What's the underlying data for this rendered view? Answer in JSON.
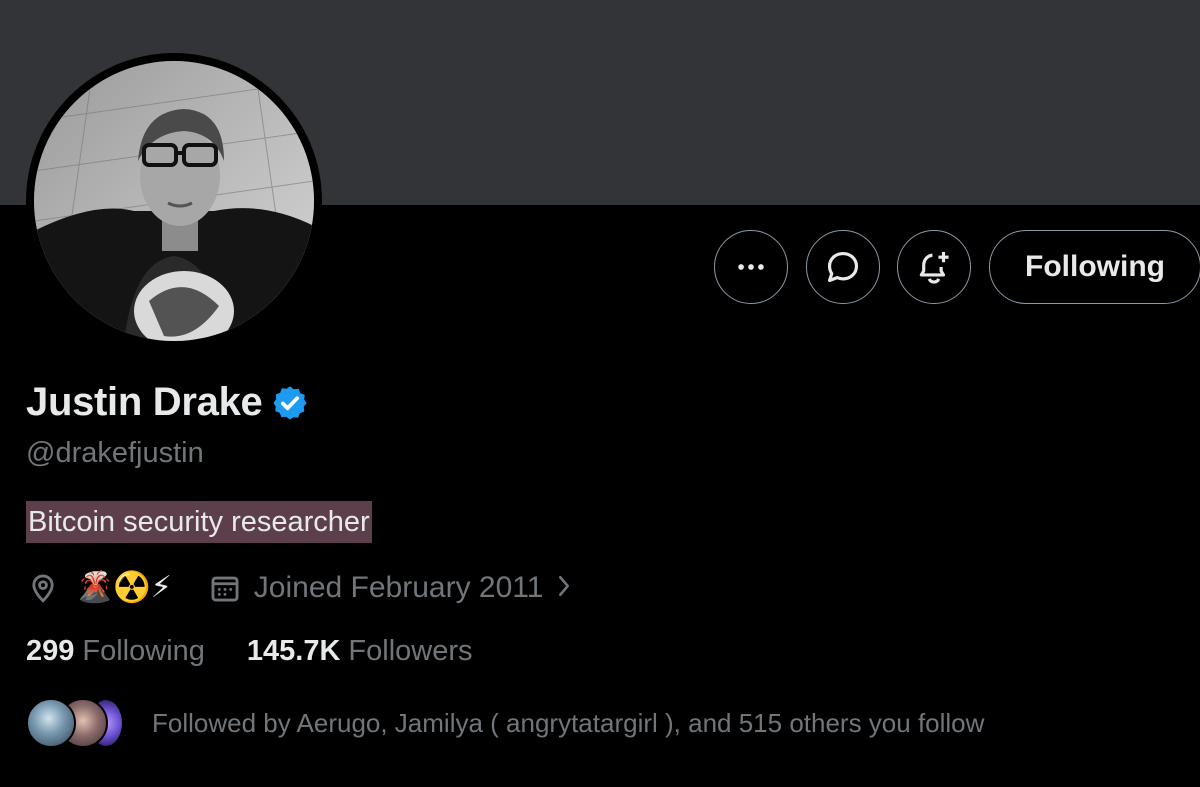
{
  "profile": {
    "display_name": "Justin Drake",
    "handle": "@drakefjustin",
    "bio": "Bitcoin security researcher",
    "location": "🌋☢️⚡",
    "joined": "Joined February 2011",
    "verified": true
  },
  "actions": {
    "more_icon": "more-horizontal-icon",
    "message_icon": "message-bubble-icon",
    "notify_icon": "bell-plus-icon",
    "follow_label": "Following"
  },
  "stats": {
    "following_count": "299",
    "following_label": "Following",
    "followers_count": "145.7K",
    "followers_label": "Followers"
  },
  "followed_by": {
    "text": "Followed by Aerugo, Jamilya ( angrytatargirl ), and 515 others you follow"
  },
  "colors": {
    "background": "#000000",
    "banner": "#333438",
    "verified": "#1d9bf0",
    "muted_text": "#71767b",
    "bio_highlight": "#5d3f4c"
  }
}
